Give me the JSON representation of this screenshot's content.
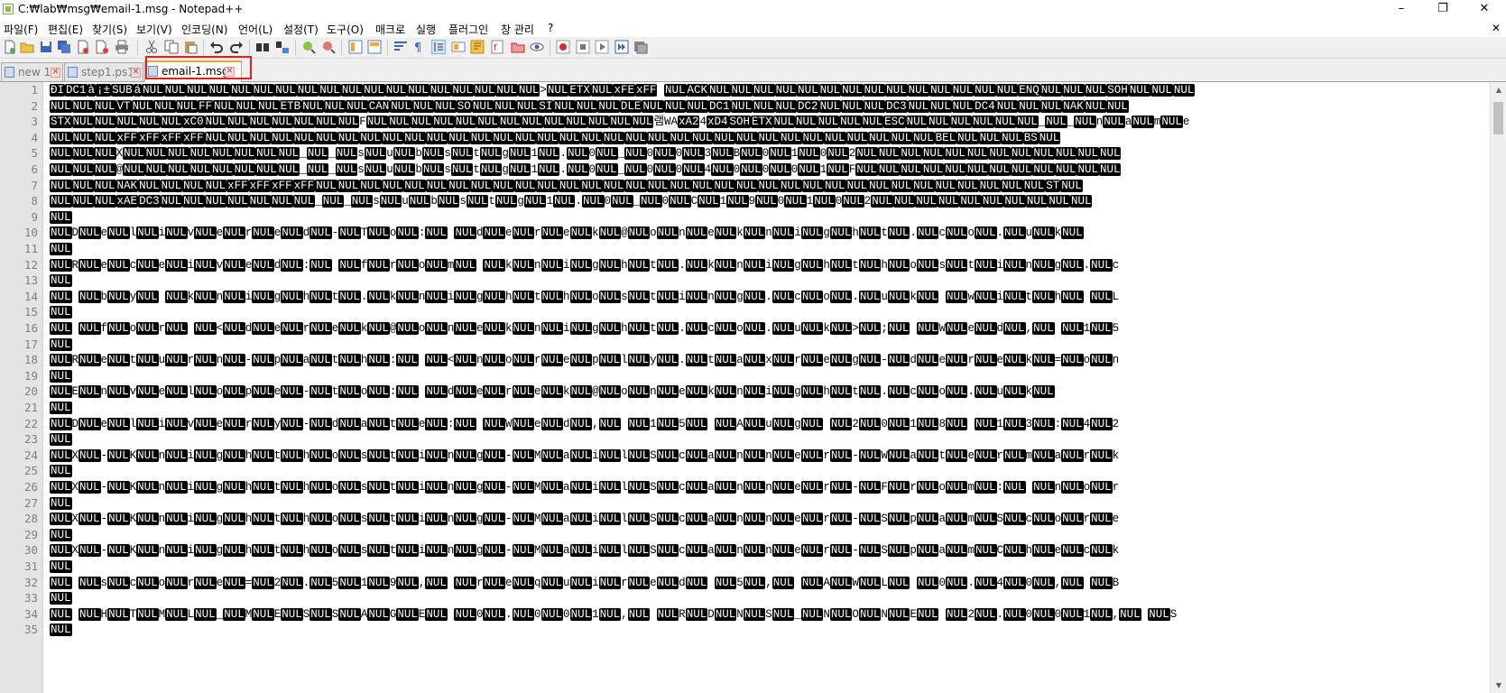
{
  "window": {
    "title": "C:₩lab₩msg₩email-1.msg - Notepad++",
    "min": "–",
    "max": "❐",
    "close": "✕"
  },
  "menu": [
    "파일(F)",
    "편집(E)",
    "찾기(S)",
    "보기(V)",
    "인코딩(N)",
    "언어(L)",
    "설정(T)",
    "도구(O)",
    "매크로",
    "실행",
    "플러그인",
    "창 관리",
    "?"
  ],
  "menu_close": "✕",
  "toolbar_icons": [
    "new-file-icon",
    "open-file-icon",
    "save-icon",
    "save-all-icon",
    "close-icon",
    "close-all-icon",
    "print-icon",
    "cut-icon",
    "copy-icon",
    "paste-icon",
    "undo-icon",
    "redo-icon",
    "find-icon",
    "replace-icon",
    "zoom-in-icon",
    "zoom-out-icon",
    "sync-vertical-icon",
    "sync-horizontal-icon",
    "word-wrap-icon",
    "show-all-chars-icon",
    "indent-guide-icon",
    "udl-icon",
    "doc-map-icon",
    "function-list-icon",
    "folder-workspace-icon",
    "monitor-icon",
    "record-macro-icon",
    "stop-record-icon",
    "play-macro-icon",
    "run-macro-multiple-icon",
    "save-macro-icon"
  ],
  "tabs": [
    {
      "label": "new 1",
      "active": false
    },
    {
      "label": "step1.ps1",
      "active": false
    },
    {
      "label": "email-1.msg",
      "active": true
    }
  ],
  "tab_close_glyph": "✕",
  "colors": {
    "control_char_bg": "#000000",
    "highlight_border": "#e02020",
    "gutter": "#e4e4e4"
  },
  "line_numbers": [
    "1",
    "2",
    "3",
    "4",
    "5",
    "6",
    "7",
    "8",
    "9",
    "10",
    "11",
    "12",
    "13",
    "14",
    "15",
    "16",
    "17",
    "18",
    "19",
    "20",
    "21",
    "22",
    "23",
    "24",
    "25",
    "26",
    "27",
    "28",
    "29",
    "30",
    "31",
    "32",
    "33",
    "34",
    "35"
  ],
  "lines": [
    "{{ÐI}}{{DC1}}{{à}}{{¡±}}{{SUB}}{{á}}{{NUL}}{{NUL}}{{NUL}}{{NUL}}{{NUL}}{{NUL}}{{NUL}}{{NUL}}{{NUL}}{{NUL}}{{NUL}}{{NUL}}{{NUL}}{{NUL}}{{NUL}}{{NUL}}{{NUL}}{{NUL}}>{{NUL}}{{ETX}}{{NUL}}{{xFE}}{{xFF}} {{NUL}}{{ACK}}{{NUL}}{{NUL}}{{NUL}}{{NUL}}{{NUL}}{{NUL}}{{NUL}}{{NUL}}{{NUL}}{{NUL}}{{NUL}}{{NUL}}{{NUL}}{{NUL}}{{ENQ}}{{NUL}}{{NUL}}{{NUL}}{{SOH}}{{NUL}}{{NUL}}{{NUL}}",
    "{{NUL}}{{NUL}}{{NUL}}{{VT}}{{NUL}}{{NUL}}{{NUL}}{{FF}}{{NUL}}{{NUL}}{{NUL}}{{ETB}}{{NUL}}{{NUL}}{{NUL}}{{CAN}}{{NUL}}{{NUL}}{{NUL}}{{SO}}{{NUL}}{{NUL}}{{NUL}}{{SI}}{{NUL}}{{NUL}}{{NUL}}{{DLE}}{{NUL}}{{NUL}}{{NUL}}{{DC1}}{{NUL}}{{NUL}}{{NUL}}{{DC2}}{{NUL}}{{NUL}}{{NUL}}{{DC3}}{{NUL}}{{NUL}}{{NUL}}{{DC4}}{{NUL}}{{NUL}}{{NUL}}{{NAK}}{{NUL}}{{NUL}}",
    "{{STX}}{{NUL}}{{NUL}}{{NUL}}{{NUL}}{{NUL}}{{xC0}}{{NUL}}{{NUL}}{{NUL}}{{NUL}}{{NUL}}{{NUL}}{{NUL}}F{{NUL}}{{NUL}}{{NUL}}{{NUL}}{{NUL}}{{NUL}}{{NUL}}{{NUL}}{{NUL}}{{NUL}}{{NUL}}{{NUL}}{{NUL}}램WA{{xA2}}4{{xD4}}{{SOH}}{{ETX}}{{NUL}}{{NUL}}{{NUL}}{{NUL}}{{NUL}}{{ESC}}{{NUL}}{{NUL}}{{NUL}}{{NUL}}{{NUL}}{{NUL}}_{{NUL}}_{{NUL}}n{{NUL}}a{{NUL}}m{{NUL}}e",
    "{{NUL}}{{NUL}}{{NUL}}{{xFF}}{{xFF}}{{xFF}}{{xFF}}{{NUL}}{{NUL}}{{NUL}}{{NUL}}{{NUL}}{{NUL}}{{NUL}}{{NUL}}{{NUL}}{{NUL}}{{NUL}}{{NUL}}{{NUL}}{{NUL}}{{NUL}}{{NUL}}{{NUL}}{{NUL}}{{NUL}}{{NUL}}{{NUL}}{{NUL}}{{NUL}}{{NUL}}{{NUL}}{{NUL}}{{NUL}}{{NUL}}{{NUL}}{{NUL}}{{NUL}}{{NUL}}{{NUL}}{{BEL}}{{NUL}}{{NUL}}{{NUL}}{{BS}}{{NUL}}",
    "{{NUL}}{{NUL}}{{NUL}}X{{NUL}}{{NUL}}{{NUL}}{{NUL}}{{NUL}}{{NUL}}{{NUL}}{{NUL}}_{{NUL}}_{{NUL}}s{{NUL}}u{{NUL}}b{{NUL}}s{{NUL}}t{{NUL}}g{{NUL}}1{{NUL}}.{{NUL}}0{{NUL}}_{{NUL}}0{{NUL}}0{{NUL}}3{{NUL}}B{{NUL}}0{{NUL}}1{{NUL}}0{{NUL}}2{{NUL}}{{NUL}}{{NUL}}{{NUL}}{{NUL}}{{NUL}}{{NUL}}{{NUL}}{{NUL}}{{NUL}}{{NUL}}{{NUL}}",
    "{{NUL}}{{NUL}}{{NUL}}@{{NUL}}{{NUL}}{{NUL}}{{NUL}}{{NUL}}{{NUL}}{{NUL}}{{NUL}}_{{NUL}}_{{NUL}}s{{NUL}}u{{NUL}}b{{NUL}}s{{NUL}}t{{NUL}}g{{NUL}}1{{NUL}}.{{NUL}}0{{NUL}}_{{NUL}}0{{NUL}}0{{NUL}}4{{NUL}}0{{NUL}}0{{NUL}}0{{NUL}}1{{NUL}}F{{NUL}}{{NUL}}{{NUL}}{{NUL}}{{NUL}}{{NUL}}{{NUL}}{{NUL}}{{NUL}}{{NUL}}{{NUL}}{{NUL}}",
    "{{NUL}}{{NUL}}{{NUL}}{{NAK}}{{NUL}}{{NUL}}{{NUL}}{{NUL}}{{xFF}}{{xFF}}{{xFF}}{{xFF}}{{NUL}}{{NUL}}{{NUL}}{{NUL}}{{NUL}}{{NUL}}{{NUL}}{{NUL}}{{NUL}}{{NUL}}{{NUL}}{{NUL}}{{NUL}}{{NUL}}{{NUL}}{{NUL}}{{NUL}}{{NUL}}{{NUL}}{{NUL}}{{NUL}}{{NUL}}{{NUL}}{{NUL}}{{NUL}}{{NUL}}{{NUL}}{{NUL}}{{NUL}}{{NUL}}{{NUL}}{{NUL}}{{NUL}}{{ST}}{{NUL}}",
    "{{NUL}}{{NUL}}{{NUL}}{{xAE}}{{DC3}}{{NUL}}{{NUL}}{{NUL}}{{NUL}}{{NUL}}{{NUL}}{{NUL}}_{{NUL}}_{{NUL}}s{{NUL}}u{{NUL}}b{{NUL}}s{{NUL}}t{{NUL}}g{{NUL}}1{{NUL}}.{{NUL}}0{{NUL}}_{{NUL}}0{{NUL}}C{{NUL}}1{{NUL}}9{{NUL}}0{{NUL}}1{{NUL}}0{{NUL}}2{{NUL}}{{NUL}}{{NUL}}{{NUL}}{{NUL}}{{NUL}}{{NUL}}{{NUL}}{{NUL}}{{NUL}}",
    "{{NUL}}",
    "{{NUL}}D{{NUL}}e{{NUL}}l{{NUL}}i{{NUL}}v{{NUL}}e{{NUL}}r{{NUL}}e{{NUL}}d{{NUL}}-{{NUL}}T{{NUL}}o{{NUL}}:{{NUL}} {{NUL}}d{{NUL}}e{{NUL}}r{{NUL}}e{{NUL}}k{{NUL}}@{{NUL}}o{{NUL}}n{{NUL}}e{{NUL}}k{{NUL}}n{{NUL}}i{{NUL}}g{{NUL}}h{{NUL}}t{{NUL}}.{{NUL}}c{{NUL}}o{{NUL}}.{{NUL}}u{{NUL}}k{{NUL}}",
    "{{NUL}}",
    "{{NUL}}R{{NUL}}e{{NUL}}c{{NUL}}e{{NUL}}i{{NUL}}v{{NUL}}e{{NUL}}d{{NUL}}:{{NUL}} {{NUL}}f{{NUL}}r{{NUL}}o{{NUL}}m{{NUL}} {{NUL}}k{{NUL}}n{{NUL}}i{{NUL}}g{{NUL}}h{{NUL}}t{{NUL}}.{{NUL}}k{{NUL}}n{{NUL}}i{{NUL}}g{{NUL}}h{{NUL}}t{{NUL}}h{{NUL}}o{{NUL}}s{{NUL}}t{{NUL}}i{{NUL}}n{{NUL}}g{{NUL}}.{{NUL}}c",
    "{{NUL}}",
    "{{NUL}} {{NUL}}b{{NUL}}y{{NUL}} {{NUL}}k{{NUL}}n{{NUL}}i{{NUL}}g{{NUL}}h{{NUL}}t{{NUL}}.{{NUL}}k{{NUL}}n{{NUL}}i{{NUL}}g{{NUL}}h{{NUL}}t{{NUL}}h{{NUL}}o{{NUL}}s{{NUL}}t{{NUL}}i{{NUL}}n{{NUL}}g{{NUL}}.{{NUL}}c{{NUL}}o{{NUL}}.{{NUL}}u{{NUL}}k{{NUL}} {{NUL}}w{{NUL}}i{{NUL}}t{{NUL}}h{{NUL}} {{NUL}}L",
    "{{NUL}}",
    "{{NUL}} {{NUL}}f{{NUL}}o{{NUL}}r{{NUL}} {{NUL}}<{{NUL}}d{{NUL}}e{{NUL}}r{{NUL}}e{{NUL}}k{{NUL}}@{{NUL}}o{{NUL}}n{{NUL}}e{{NUL}}k{{NUL}}n{{NUL}}i{{NUL}}g{{NUL}}h{{NUL}}t{{NUL}}.{{NUL}}c{{NUL}}o{{NUL}}.{{NUL}}u{{NUL}}k{{NUL}}>{{NUL}};{{NUL}} {{NUL}}W{{NUL}}e{{NUL}}d{{NUL}},{{NUL}} {{NUL}}1{{NUL}}5",
    "{{NUL}}",
    "{{NUL}}R{{NUL}}e{{NUL}}t{{NUL}}u{{NUL}}r{{NUL}}n{{NUL}}-{{NUL}}p{{NUL}}a{{NUL}}t{{NUL}}h{{NUL}}:{{NUL}} {{NUL}}<{{NUL}}n{{NUL}}o{{NUL}}r{{NUL}}e{{NUL}}p{{NUL}}l{{NUL}}y{{NUL}}.{{NUL}}t{{NUL}}a{{NUL}}x{{NUL}}r{{NUL}}e{{NUL}}g{{NUL}}-{{NUL}}d{{NUL}}e{{NUL}}r{{NUL}}e{{NUL}}k{{NUL}}={{NUL}}o{{NUL}}n",
    "{{NUL}}",
    "{{NUL}}E{{NUL}}n{{NUL}}v{{NUL}}e{{NUL}}l{{NUL}}o{{NUL}}p{{NUL}}e{{NUL}}-{{NUL}}t{{NUL}}o{{NUL}}:{{NUL}} {{NUL}}d{{NUL}}e{{NUL}}r{{NUL}}e{{NUL}}k{{NUL}}@{{NUL}}o{{NUL}}n{{NUL}}e{{NUL}}k{{NUL}}n{{NUL}}i{{NUL}}g{{NUL}}h{{NUL}}t{{NUL}}.{{NUL}}c{{NUL}}o{{NUL}}.{{NUL}}u{{NUL}}k{{NUL}}",
    "{{NUL}}",
    "{{NUL}}D{{NUL}}e{{NUL}}l{{NUL}}i{{NUL}}v{{NUL}}e{{NUL}}r{{NUL}}y{{NUL}}-{{NUL}}d{{NUL}}a{{NUL}}t{{NUL}}e{{NUL}}:{{NUL}} {{NUL}}W{{NUL}}e{{NUL}}d{{NUL}},{{NUL}} {{NUL}}1{{NUL}}5{{NUL}} {{NUL}}A{{NUL}}u{{NUL}}g{{NUL}} {{NUL}}2{{NUL}}0{{NUL}}1{{NUL}}8{{NUL}} {{NUL}}1{{NUL}}3{{NUL}}:{{NUL}}4{{NUL}}2",
    "{{NUL}}",
    "{{NUL}}X{{NUL}}-{{NUL}}K{{NUL}}n{{NUL}}i{{NUL}}g{{NUL}}h{{NUL}}t{{NUL}}h{{NUL}}o{{NUL}}s{{NUL}}t{{NUL}}i{{NUL}}n{{NUL}}g{{NUL}}-{{NUL}}M{{NUL}}a{{NUL}}i{{NUL}}l{{NUL}}S{{NUL}}c{{NUL}}a{{NUL}}n{{NUL}}n{{NUL}}e{{NUL}}r{{NUL}}-{{NUL}}W{{NUL}}a{{NUL}}t{{NUL}}e{{NUL}}r{{NUL}}m{{NUL}}a{{NUL}}r{{NUL}}k",
    "{{NUL}}",
    "{{NUL}}X{{NUL}}-{{NUL}}K{{NUL}}n{{NUL}}i{{NUL}}g{{NUL}}h{{NUL}}t{{NUL}}h{{NUL}}o{{NUL}}s{{NUL}}t{{NUL}}i{{NUL}}n{{NUL}}g{{NUL}}-{{NUL}}M{{NUL}}a{{NUL}}i{{NUL}}l{{NUL}}S{{NUL}}c{{NUL}}a{{NUL}}n{{NUL}}n{{NUL}}e{{NUL}}r{{NUL}}-{{NUL}}F{{NUL}}r{{NUL}}o{{NUL}}m{{NUL}}:{{NUL}} {{NUL}}n{{NUL}}o{{NUL}}r",
    "{{NUL}}",
    "{{NUL}}X{{NUL}}-{{NUL}}K{{NUL}}n{{NUL}}i{{NUL}}g{{NUL}}h{{NUL}}t{{NUL}}h{{NUL}}o{{NUL}}s{{NUL}}t{{NUL}}i{{NUL}}n{{NUL}}g{{NUL}}-{{NUL}}M{{NUL}}a{{NUL}}i{{NUL}}l{{NUL}}S{{NUL}}c{{NUL}}a{{NUL}}n{{NUL}}n{{NUL}}e{{NUL}}r{{NUL}}-{{NUL}}S{{NUL}}p{{NUL}}a{{NUL}}m{{NUL}}S{{NUL}}c{{NUL}}o{{NUL}}r{{NUL}}e",
    "{{NUL}}",
    "{{NUL}}X{{NUL}}-{{NUL}}K{{NUL}}n{{NUL}}i{{NUL}}g{{NUL}}h{{NUL}}t{{NUL}}h{{NUL}}o{{NUL}}s{{NUL}}t{{NUL}}i{{NUL}}n{{NUL}}g{{NUL}}-{{NUL}}M{{NUL}}a{{NUL}}i{{NUL}}l{{NUL}}S{{NUL}}c{{NUL}}a{{NUL}}n{{NUL}}n{{NUL}}e{{NUL}}r{{NUL}}-{{NUL}}S{{NUL}}p{{NUL}}a{{NUL}}m{{NUL}}C{{NUL}}h{{NUL}}e{{NUL}}c{{NUL}}k",
    "{{NUL}}",
    "{{NUL}} {{NUL}}s{{NUL}}c{{NUL}}o{{NUL}}r{{NUL}}e{{NUL}}={{NUL}}2{{NUL}}.{{NUL}}5{{NUL}}1{{NUL}}9{{NUL}},{{NUL}} {{NUL}}r{{NUL}}e{{NUL}}q{{NUL}}u{{NUL}}i{{NUL}}r{{NUL}}e{{NUL}}d{{NUL}} {{NUL}}5{{NUL}},{{NUL}} {{NUL}}A{{NUL}}W{{NUL}}L{{NUL}} {{NUL}}0{{NUL}}.{{NUL}}4{{NUL}}0{{NUL}},{{NUL}} {{NUL}}B",
    "{{NUL}}",
    "{{NUL}} {{NUL}}H{{NUL}}T{{NUL}}M{{NUL}}L{{NUL}}_{{NUL}}M{{NUL}}E{{NUL}}S{{NUL}}S{{NUL}}A{{NUL}}G{{NUL}}E{{NUL}} {{NUL}}0{{NUL}}.{{NUL}}0{{NUL}}0{{NUL}}1{{NUL}},{{NUL}} {{NUL}}R{{NUL}}D{{NUL}}N{{NUL}}S{{NUL}}_{{NUL}}N{{NUL}}O{{NUL}}N{{NUL}}E{{NUL}} {{NUL}}2{{NUL}}.{{NUL}}0{{NUL}}0{{NUL}}1{{NUL}},{{NUL}} {{NUL}}S",
    "{{NUL}}"
  ]
}
